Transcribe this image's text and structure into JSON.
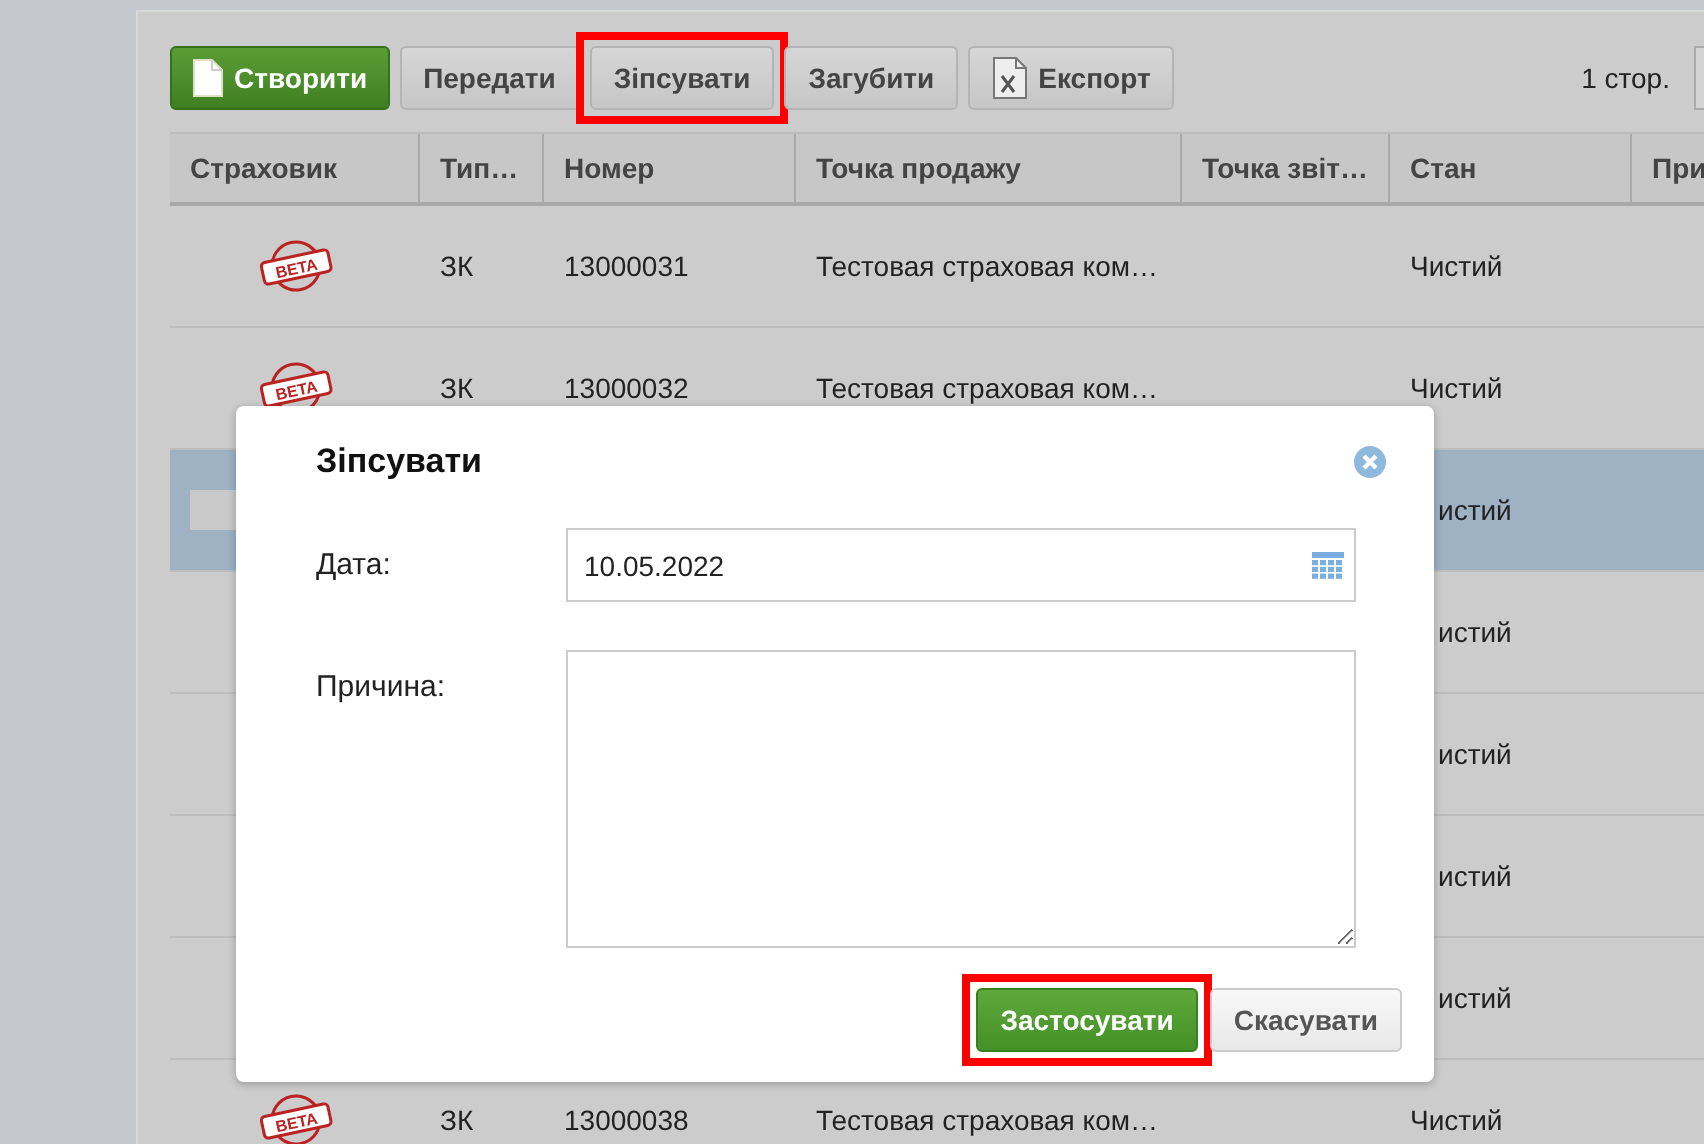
{
  "toolbar": {
    "buttons": [
      {
        "label": "Створити",
        "kind": "create",
        "highlighted": false
      },
      {
        "label": "Передати",
        "kind": "plain",
        "highlighted": false
      },
      {
        "label": "Зіпсувати",
        "kind": "plain",
        "highlighted": true
      },
      {
        "label": "Загубити",
        "kind": "plain",
        "highlighted": false
      },
      {
        "label": "Експорт",
        "kind": "export",
        "highlighted": false
      }
    ],
    "pager": "1 стор."
  },
  "table": {
    "columns": [
      "Страховик",
      "Тип…",
      "Номер",
      "Точка продажу",
      "Точка звіт…",
      "Стан",
      "При"
    ],
    "rows": [
      {
        "insurer": "BETA",
        "type": "ЗК",
        "number": "13000031",
        "point": "Тестовая страховая ком…",
        "state": "Чистий",
        "selected": false,
        "hidden": false
      },
      {
        "insurer": "BETA",
        "type": "ЗК",
        "number": "13000032",
        "point": "Тестовая страховая ком…",
        "state": "Чистий",
        "selected": false,
        "hidden": false
      },
      {
        "state": "истий",
        "selected": true,
        "hidden": true
      },
      {
        "state": "истий",
        "selected": false,
        "hidden": true
      },
      {
        "state": "истий",
        "selected": false,
        "hidden": true
      },
      {
        "state": "истий",
        "selected": false,
        "hidden": true
      },
      {
        "state": "истий",
        "selected": false,
        "hidden": true
      },
      {
        "insurer": "BETA",
        "type": "ЗК",
        "number": "13000038",
        "point": "Тестовая страховая ком…",
        "state": "Чистий",
        "selected": false,
        "hidden": false
      }
    ]
  },
  "dialog": {
    "title": "Зіпсувати",
    "date_label": "Дата:",
    "date_value": "10.05.2022",
    "reason_label": "Причина:",
    "buttons": [
      {
        "label": "Застосувати",
        "kind": "primary",
        "highlighted": true
      },
      {
        "label": "Скасувати",
        "kind": "secondary",
        "highlighted": false
      }
    ]
  }
}
